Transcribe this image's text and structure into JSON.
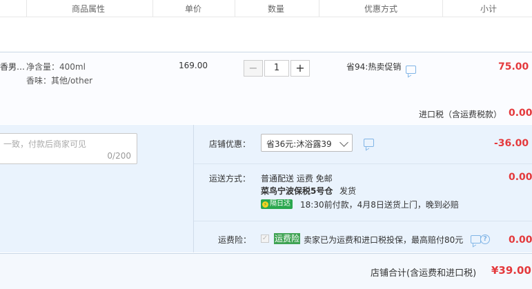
{
  "header": {
    "columns": [
      "商品属性",
      "单价",
      "数量",
      "优惠方式",
      "小计"
    ]
  },
  "item": {
    "name_fragment": "香男…",
    "attrs": [
      "净含量：400ml",
      "香味：其他/other"
    ],
    "unit_price": "169.00",
    "quantity": "1",
    "minus": "−",
    "plus": "+",
    "promo": "省94:热卖促销",
    "subtotal": "75.00"
  },
  "tax": {
    "label": "进口税（含运费税款）",
    "value": "0.00"
  },
  "message": {
    "placeholder": "一致，付款后商家可见",
    "counter": "0/200"
  },
  "store_discount": {
    "label": "店铺优惠：",
    "selected": "省36元:沐浴露39",
    "value": "-36.00"
  },
  "shipping": {
    "label": "运送方式：",
    "method": "普通配送 运费 免邮",
    "warehouse": "菜鸟宁波保税5号仓",
    "ship_note": "发货",
    "badge": "隔日达",
    "badge_icon": "⚡",
    "schedule": "18:30前付款，4月8日送货上门，晚到必赔",
    "value": "0.00"
  },
  "insurance": {
    "label": "运费险：",
    "badge": "运费险",
    "text": "卖家已为运费和进口税投保，最高赔付80元",
    "help": "?",
    "value": "0.00"
  },
  "total": {
    "label": "店铺合计(含运费和进口税)",
    "value": "¥39.00"
  },
  "colors": {
    "price_red": "#e4393c",
    "panel_blue": "#eaf3fd",
    "badge_green": "#2aa74e"
  }
}
